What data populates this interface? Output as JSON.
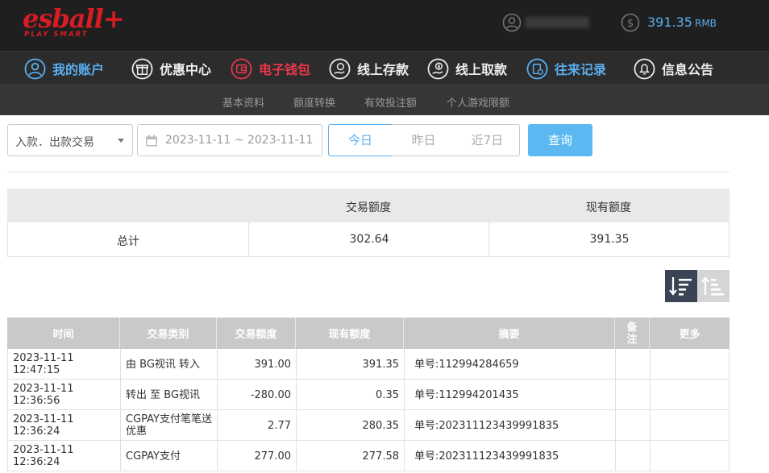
{
  "brand": {
    "logo": "esball+",
    "tagline": "PLAY SMART",
    "accent": "#d71c24"
  },
  "account": {
    "balance": "391.35",
    "currency": "RMB"
  },
  "nav": [
    {
      "label": "我的账户",
      "icon": "user-icon"
    },
    {
      "label": "优惠中心",
      "icon": "gift-icon"
    },
    {
      "label": "电子钱包",
      "icon": "wallet-icon"
    },
    {
      "label": "线上存款",
      "icon": "deposit-icon"
    },
    {
      "label": "线上取款",
      "icon": "withdraw-icon"
    },
    {
      "label": "往来记录",
      "icon": "records-icon"
    },
    {
      "label": "信息公告",
      "icon": "bell-icon"
    }
  ],
  "subnav": [
    "基本资料",
    "额度转换",
    "有效投注额",
    "个人游戏限额"
  ],
  "filters": {
    "type": "入款．出款交易",
    "date_range": "2023-11-11 ~ 2023-11-11",
    "today": "今日",
    "yesterday": "昨日",
    "last7": "近7日",
    "query": "查询"
  },
  "summary": {
    "col_amount": "交易额度",
    "col_balance": "现有额度",
    "row_label": "总计",
    "amount": "302.64",
    "balance": "391.35"
  },
  "table": {
    "headers": {
      "time": "时间",
      "type": "交易类别",
      "amount": "交易额度",
      "balance": "现有额度",
      "summary": "摘要",
      "note": "备注",
      "more": "更多"
    },
    "rows": [
      {
        "time": "2023-11-11 12:47:15",
        "type": "由 BG视讯 转入",
        "amount": "391.00",
        "balance": "391.35",
        "summary": "单号:112994284659"
      },
      {
        "time": "2023-11-11 12:36:56",
        "type": "转出 至 BG视讯",
        "amount": "-280.00",
        "balance": "0.35",
        "summary": "单号:112994201435"
      },
      {
        "time": "2023-11-11 12:36:24",
        "type": "CGPAY支付笔笔送优惠",
        "amount": "2.77",
        "balance": "280.35",
        "summary": "单号:202311123439991835"
      },
      {
        "time": "2023-11-11 12:36:24",
        "type": "CGPAY支付",
        "amount": "277.00",
        "balance": "277.58",
        "summary": "单号:202311123439991835"
      }
    ]
  }
}
